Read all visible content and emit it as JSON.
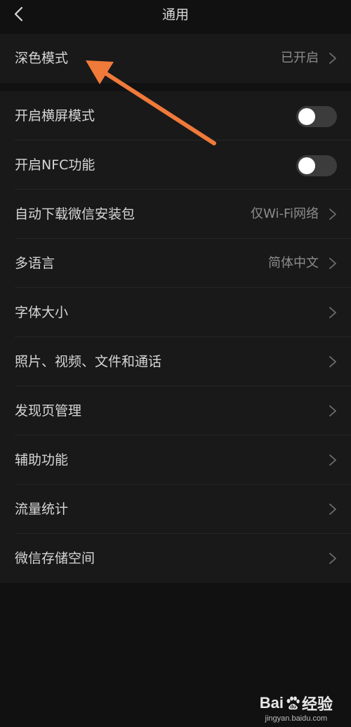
{
  "header": {
    "title": "通用"
  },
  "dark_mode": {
    "label": "深色模式",
    "value": "已开启"
  },
  "settings": {
    "landscape": {
      "label": "开启横屏模式",
      "on": false
    },
    "nfc": {
      "label": "开启NFC功能",
      "on": false
    },
    "auto_download": {
      "label": "自动下载微信安装包",
      "value": "仅Wi-Fi网络"
    },
    "language": {
      "label": "多语言",
      "value": "简体中文"
    },
    "font_size": {
      "label": "字体大小"
    },
    "media": {
      "label": "照片、视频、文件和通话"
    },
    "discover": {
      "label": "发现页管理"
    },
    "accessibility": {
      "label": "辅助功能"
    },
    "traffic": {
      "label": "流量统计"
    },
    "storage": {
      "label": "微信存储空间"
    }
  },
  "annotation": {
    "arrow_color": "#f07a3a"
  },
  "watermark": {
    "brand_left": "Bai",
    "brand_right": "经验",
    "url": "jingyan.baidu.com"
  },
  "colors": {
    "background": "#111111",
    "cell": "#191919",
    "text": "#d6d6d6",
    "secondary_text": "#8c8c8c"
  }
}
